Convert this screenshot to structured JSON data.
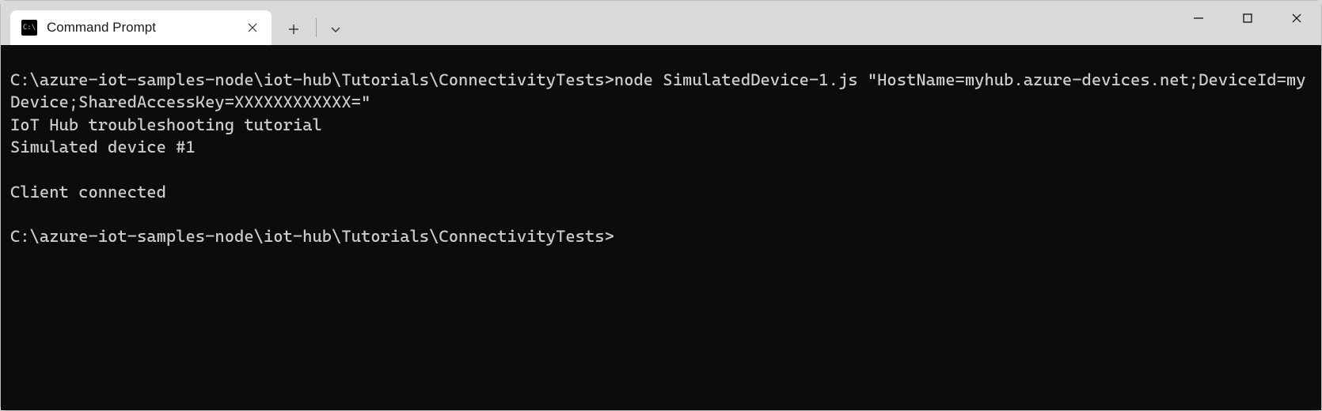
{
  "window": {
    "tab_title": "Command Prompt"
  },
  "terminal": {
    "lines": [
      "C:\\azure-iot-samples-node\\iot-hub\\Tutorials\\ConnectivityTests>node SimulatedDevice-1.js \"HostName=myhub.azure-devices.net;DeviceId=myDevice;SharedAccessKey=XXXXXXXXXXXX=\"",
      "IoT Hub troubleshooting tutorial",
      "Simulated device #1",
      "",
      "Client connected",
      "",
      "C:\\azure-iot-samples-node\\iot-hub\\Tutorials\\ConnectivityTests>"
    ]
  }
}
